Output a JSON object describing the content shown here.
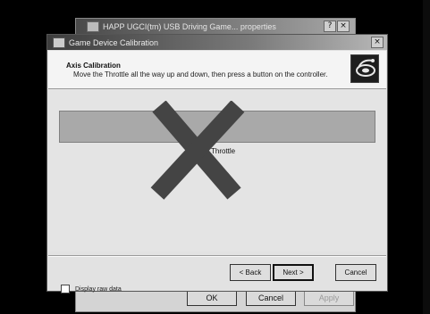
{
  "back_window": {
    "title": "HAPP UGCI(tm) USB Driving Game... properties",
    "title_buttons": [
      "?",
      "×"
    ],
    "buttons": {
      "ok": "OK",
      "cancel": "Cancel",
      "apply": "Apply"
    }
  },
  "dialog": {
    "title": "Game Device Calibration",
    "close": "×",
    "header": {
      "title": "Axis Calibration",
      "subtitle": "Move the Throttle all the way up and down, then press a button on the controller."
    },
    "axis_label": "Throttle",
    "checkbox_label": "Display raw data",
    "checkbox_checked": false,
    "buttons": {
      "back": "< Back",
      "next": "Next >",
      "cancel": "Cancel"
    }
  },
  "icons": {
    "back_window": "window-icon",
    "dialog": "window-icon",
    "header": "game-controller-icon",
    "cross": "cross-marker-icon"
  },
  "colors": {
    "background": "#000000",
    "titlebar": "#4a4a4a",
    "bar": "#a9a9a9",
    "cross": "#444444"
  }
}
